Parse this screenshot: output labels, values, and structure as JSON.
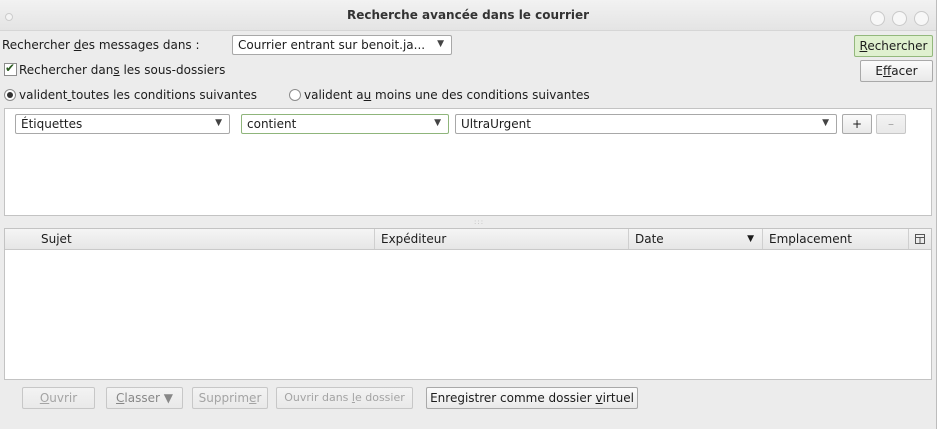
{
  "window": {
    "title": "Recherche avancée dans le courrier"
  },
  "search_in": {
    "label_prefix": "Rechercher ",
    "label_mnemonic": "d",
    "label_suffix": "es messages dans :",
    "folder_value": "Courrier entrant sur benoit.ja...",
    "search_button": "R",
    "search_button_rest": "echercher",
    "clear_button_pre": "E",
    "clear_button_mn": "f",
    "clear_button_post": "facer"
  },
  "subfolders": {
    "label_pre": "Rechercher dan",
    "label_mn": "s",
    "label_post": " les sous-dossiers",
    "checked": true
  },
  "match": {
    "all_pre": "valident",
    "all_mn": " ",
    "all_post": "toutes les conditions suivantes",
    "any_pre": "valident a",
    "any_mn": "u",
    "any_post": " moins une des conditions suivantes",
    "selected": "all"
  },
  "condition": {
    "field": "Étiquettes",
    "operator": "contient",
    "value": "UltraUrgent",
    "add_label": "+",
    "remove_label": "–"
  },
  "columns": {
    "subject": "Sujet",
    "sender": "Expéditeur",
    "date": "Date",
    "date_sort_arrow": "▼",
    "location": "Emplacement"
  },
  "actions": {
    "open_mn": "O",
    "open_rest": "uvrir",
    "file_mn": "C",
    "file_rest": "lasser ▼",
    "delete_pre": "Supprim",
    "delete_mn": "e",
    "delete_post": "r",
    "open_folder_pre": "Ouvrir dans ",
    "open_folder_mn": "l",
    "open_folder_post": "e dossier",
    "save_virtual_pre": "Enregistrer comme dossier ",
    "save_virtual_mn": "v",
    "save_virtual_post": "irtuel"
  },
  "colors": {
    "accent_button": "#dff0cf"
  }
}
